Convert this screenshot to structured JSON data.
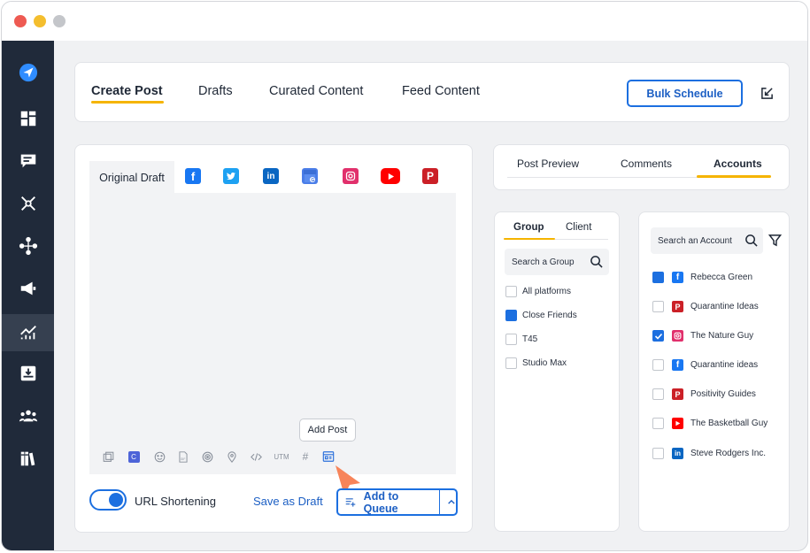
{
  "main_tabs": [
    {
      "label": "Create Post",
      "active": true
    },
    {
      "label": "Drafts",
      "active": false
    },
    {
      "label": "Curated Content",
      "active": false
    },
    {
      "label": "Feed Content",
      "active": false
    }
  ],
  "header": {
    "bulk_schedule_label": "Bulk Schedule"
  },
  "editor": {
    "original_draft_tab": "Original Draft",
    "platform_tabs": [
      "facebook-icon",
      "twitter-icon",
      "linkedin-icon",
      "google-business-icon",
      "instagram-icon",
      "youtube-icon",
      "pinterest-icon"
    ],
    "tools": [
      "media-library-icon",
      "canva-icon",
      "emoji-icon",
      "gif-icon",
      "target-icon",
      "location-icon",
      "code-icon",
      "UTM",
      "#",
      "add-post-icon"
    ],
    "tooltip": "Add Post"
  },
  "footer": {
    "url_shortening_label": "URL Shortening",
    "url_shortening_on": true,
    "save_draft_label": "Save as Draft",
    "add_queue_label": "Add to Queue"
  },
  "preview_tabs": [
    {
      "label": "Post Preview",
      "active": false
    },
    {
      "label": "Comments",
      "active": false
    },
    {
      "label": "Accounts",
      "active": true
    }
  ],
  "groups": {
    "tabs": [
      {
        "label": "Group",
        "active": true
      },
      {
        "label": "Client",
        "active": false
      }
    ],
    "search_placeholder": "Search a Group",
    "items": [
      {
        "label": "All platforms",
        "checked": false
      },
      {
        "label": "Close Friends",
        "checked": true
      },
      {
        "label": "T45",
        "checked": false
      },
      {
        "label": "Studio Max",
        "checked": false
      }
    ]
  },
  "accounts": {
    "search_placeholder": "Search an Account",
    "items": [
      {
        "label": "Rebecca Green",
        "network": "facebook",
        "checked": true,
        "check_style": "filled"
      },
      {
        "label": "Quarantine Ideas",
        "network": "pinterest",
        "checked": false
      },
      {
        "label": "The Nature Guy",
        "network": "instagram",
        "checked": true,
        "check_style": "tick"
      },
      {
        "label": "Quarantine ideas",
        "network": "facebook",
        "checked": false
      },
      {
        "label": "Positivity Guides",
        "network": "pinterest",
        "checked": false
      },
      {
        "label": "The Basketball Guy",
        "network": "youtube",
        "checked": false
      },
      {
        "label": "Steve Rodgers Inc.",
        "network": "linkedin",
        "checked": false
      }
    ]
  },
  "colors": {
    "accent": "#1c6fe0",
    "tab_underline": "#f5b400",
    "sidebar": "#202a3a"
  }
}
